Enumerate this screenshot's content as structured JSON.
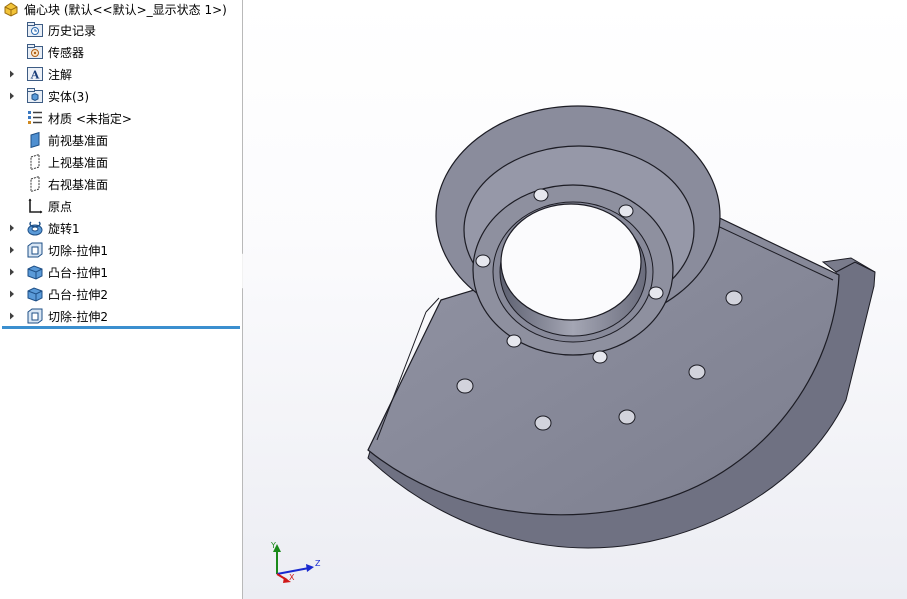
{
  "feature_tree": {
    "root_label": "偏心块  (默认<<默认>_显示状态 1>)",
    "items": [
      {
        "label": "历史记录",
        "icon": "history-folder-icon",
        "expandable": false
      },
      {
        "label": "传感器",
        "icon": "sensor-folder-icon",
        "expandable": false
      },
      {
        "label": "注解",
        "icon": "annotation-folder-icon",
        "expandable": true
      },
      {
        "label": "实体(3)",
        "icon": "solid-bodies-folder-icon",
        "expandable": true
      },
      {
        "label": "材质 <未指定>",
        "icon": "material-icon",
        "expandable": false
      },
      {
        "label": "前视基准面",
        "icon": "plane-icon",
        "expandable": false
      },
      {
        "label": "上视基准面",
        "icon": "plane-icon",
        "expandable": false
      },
      {
        "label": "右视基准面",
        "icon": "plane-icon",
        "expandable": false
      },
      {
        "label": "原点",
        "icon": "origin-icon",
        "expandable": false
      },
      {
        "label": "旋转1",
        "icon": "revolve-feature-icon",
        "expandable": true
      },
      {
        "label": "切除-拉伸1",
        "icon": "cut-extrude-feature-icon",
        "expandable": true
      },
      {
        "label": "凸台-拉伸1",
        "icon": "boss-extrude-feature-icon",
        "expandable": true
      },
      {
        "label": "凸台-拉伸2",
        "icon": "boss-extrude-feature-icon",
        "expandable": true
      },
      {
        "label": "切除-拉伸2",
        "icon": "cut-extrude-feature-icon",
        "expandable": true
      }
    ]
  },
  "triad": {
    "x_label": "X",
    "y_label": "Y",
    "z_label": "Z"
  },
  "colors": {
    "rollback_bar": "#3b8fcf",
    "part_face": "#8a8c9c",
    "part_side": "#6e7080",
    "edge": "#1c1c24",
    "axis_x": "#d01818",
    "axis_y": "#1a8a1a",
    "axis_z": "#1a2ad0"
  }
}
